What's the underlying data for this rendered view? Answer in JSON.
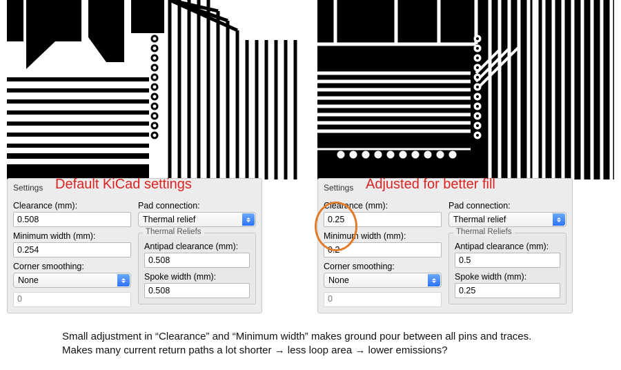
{
  "left": {
    "title": "Default KiCad settings",
    "tab": "Settings",
    "clearance_label": "Clearance (mm):",
    "clearance_value": "0.508",
    "minwidth_label": "Minimum width (mm):",
    "minwidth_value": "0.254",
    "smoothing_label": "Corner smoothing:",
    "smoothing_value": "None",
    "corner_radius_value": "0",
    "padconn_label": "Pad connection:",
    "padconn_value": "Thermal relief",
    "reliefs_title": "Thermal Reliefs",
    "antipad_label": "Antipad clearance (mm):",
    "antipad_value": "0.508",
    "spoke_label": "Spoke width (mm):",
    "spoke_value": "0.508"
  },
  "right": {
    "title": "Adjusted for better fill",
    "tab": "Settings",
    "clearance_label": "Clearance (mm):",
    "clearance_value": "0.25",
    "minwidth_label": "Minimum width (mm):",
    "minwidth_value": "0.2",
    "smoothing_label": "Corner smoothing:",
    "smoothing_value": "None",
    "corner_radius_value": "0",
    "padconn_label": "Pad connection:",
    "padconn_value": "Thermal relief",
    "reliefs_title": "Thermal Reliefs",
    "antipad_label": "Antipad clearance (mm):",
    "antipad_value": "0.5",
    "spoke_label": "Spoke width (mm):",
    "spoke_value": "0.25"
  },
  "caption_line1": "Small adjustment in “Clearance” and “Minimum width” makes ground pour between all pins and traces.",
  "caption_line2": "Makes many current return paths a lot shorter → less loop area → lower emissions?"
}
